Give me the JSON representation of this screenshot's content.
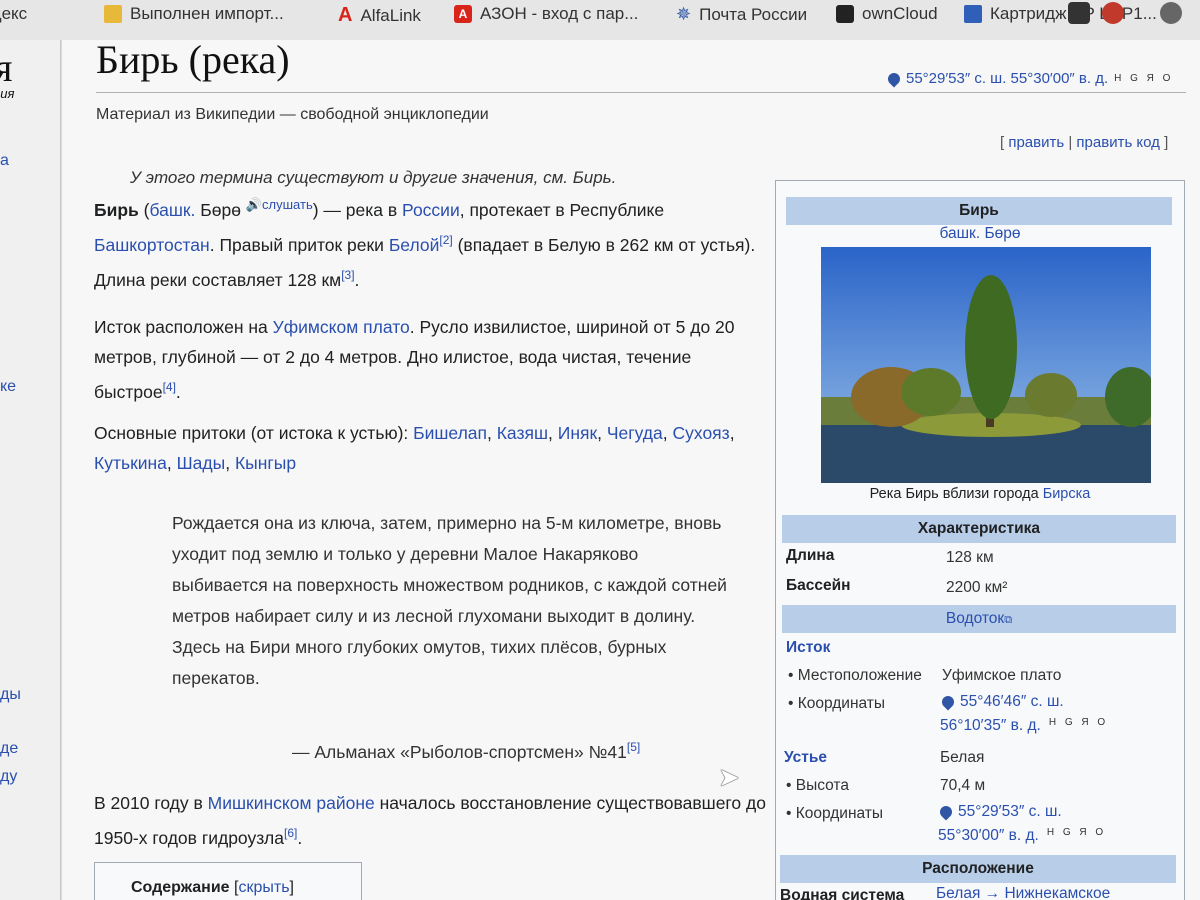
{
  "bookmarks": [
    {
      "label": "Яндекс",
      "icon": "yandex-icon"
    },
    {
      "label": "Выполнен импорт...",
      "icon": "folder-icon"
    },
    {
      "label": "AlfaLink",
      "icon": "alfa-icon"
    },
    {
      "label": "АЗОН - вход с пар...",
      "icon": "ozon-icon"
    },
    {
      "label": "Почта России",
      "icon": "russian-post-icon"
    },
    {
      "label": "ownCloud",
      "icon": "owncloud-icon"
    },
    {
      "label": "Картридж HP LJ P1...",
      "icon": "hp-icon"
    }
  ],
  "sidebar": {
    "logo": "я",
    "logo_sub": "едия",
    "fragments": [
      "а",
      "ке",
      "ды",
      "де",
      "ду"
    ]
  },
  "article": {
    "title": "Бирь (река)",
    "coordinates": "55°29′53″ с. ш. 55°30′00″ в. д.",
    "coord_tools": "H G Я O",
    "subtitle": "Материал из Википедии — свободной энциклопедии",
    "edit": "править",
    "edit_source": "править код",
    "hatnote": "У этого термина существуют и другие значения, см. Бирь.",
    "p1": {
      "name": "Бирь",
      "lang": "башк.",
      "native": "Бөрө",
      "listen": "слушать",
      "t1": ") — река в ",
      "russia": "России",
      "t2": ", протекает в Республике ",
      "bashkortostan": "Башкортостан",
      "t3": ". Правый приток реки ",
      "belaya": "Белой",
      "ref2": "[2]",
      "t4": " (впадает в Белую в 262 км от устья). Длина реки составляет 128 км",
      "ref3": "[3]"
    },
    "p2": {
      "t1": "Исток расположен на ",
      "plateau": "Уфимском плато",
      "t2": ". Русло извилистое, шириной от 5 до 20 метров, глубиной — от 2 до 4 метров. Дно илистое, вода чистая, течение быстрое",
      "ref4": "[4]"
    },
    "p3": {
      "t1": "Основные притоки (от истока к устью): ",
      "tributaries": [
        "Бишелап",
        "Казяш",
        "Иняк",
        "Чегуда",
        "Сухояз",
        "Кутькина",
        "Шады",
        "Кынгыр"
      ]
    },
    "quote": "Рождается она из ключа, затем, примерно на 5-м километре, вновь уходит под землю и только у деревни Малое Накаряково выбивается на поверхность множеством родников, с каждой сотней метров набирает силу и из лесной глухомани выходит в долину. Здесь на Бири много глубоких омутов, тихих плёсов, бурных перекатов.",
    "quote_source": "— Альманах «Рыболов-спортсмен» №41",
    "ref5": "[5]",
    "p4": {
      "t1": "В 2010 году в ",
      "district": "Мишкинском районе",
      "t2": " началось восстановление существовавшего до 1950-х годов гидроузла",
      "ref6": "[6]"
    },
    "toc_title": "Содержание",
    "toc_toggle": "скрыть"
  },
  "infobox": {
    "title": "Бирь",
    "native": "башк. Бөрө",
    "photo_caption_text": "Река Бирь вблизи города ",
    "photo_caption_link": "Бирска",
    "section_characteristics": "Характеристика",
    "length_label": "Длина",
    "length_value": "128 км",
    "basin_label": "Бассейн",
    "basin_value": "2200 км²",
    "section_watercourse": "Водоток",
    "source_label": "Исток",
    "location_label": "• Местоположение",
    "location_value": "Уфимское плато",
    "coords_label": "• Координаты",
    "source_coords_1": "55°46′46″ с. ш.",
    "source_coords_2": "56°10′35″ в. д.",
    "mouth_label": "Устье",
    "mouth_value": "Белая",
    "height_label": "• Высота",
    "height_value": "70,4 м",
    "mouth_coords_1": "55°29′53″ с. ш.",
    "mouth_coords_2": "55°30′00″ в. д.",
    "coord_tools": "H G Я O",
    "section_location": "Расположение",
    "water_system_label": "Водная система",
    "water_system_value": "Белая → Нижнекамское"
  }
}
